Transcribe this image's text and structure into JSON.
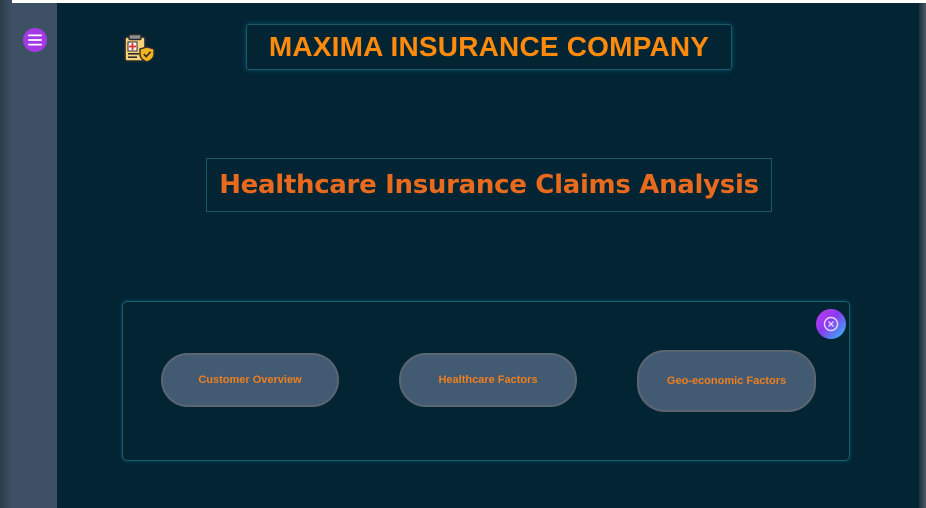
{
  "app": {
    "company_title": "MAXIMA INSURANCE COMPANY",
    "subtitle": "Healthcare Insurance Claims Analysis"
  },
  "sidebar": {
    "menu_icon": "hamburger-menu-icon"
  },
  "header": {
    "logo_icon": "medical-clipboard-shield-icon"
  },
  "navigation": {
    "buttons": [
      {
        "label": "Customer Overview"
      },
      {
        "label": "Healthcare Factors"
      },
      {
        "label": "Geo-economic Factors"
      }
    ],
    "close_icon": "close-circle-icon"
  },
  "colors": {
    "background": "#022433",
    "sidebar": "#3e5064",
    "title_orange": "#ff8a0c",
    "subtitle_orange": "#e96a1d",
    "button_fill": "#425a72",
    "menu_purple": "#a43ae6"
  }
}
